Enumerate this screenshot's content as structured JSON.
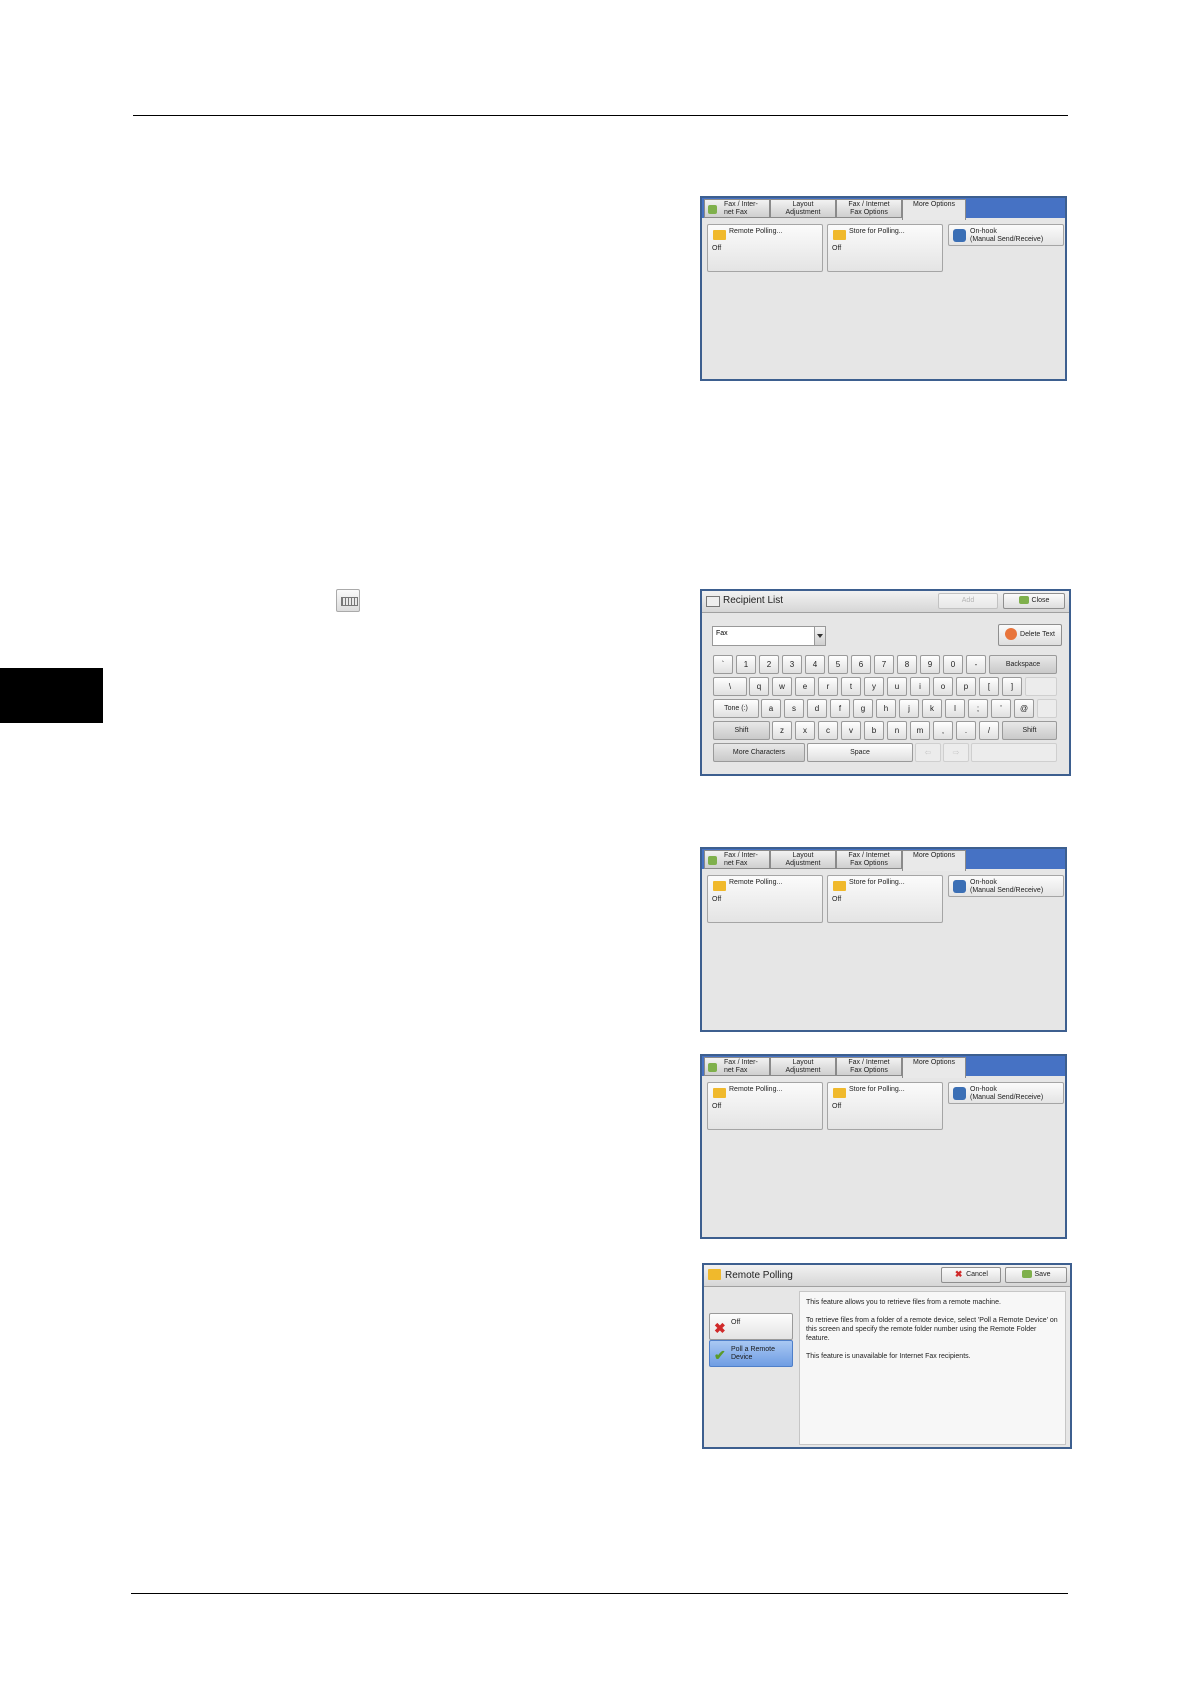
{
  "fax_tabs": {
    "tabs": [
      "Fax / Inter-\nnet Fax",
      "Layout\nAdjustment",
      "Fax / Internet\nFax Options",
      "More Options"
    ],
    "tab0_l1": "Fax / Inter-",
    "tab0_l2": "net Fax",
    "tab1_l1": "Layout",
    "tab1_l2": "Adjustment",
    "tab2_l1": "Fax / Internet",
    "tab2_l2": "Fax Options",
    "tab3": "More Options",
    "remote_polling_label": "Remote Polling...",
    "remote_polling_value": "Off",
    "store_polling_label": "Store for Polling...",
    "store_polling_value": "Off",
    "onhook_l1": "On-hook",
    "onhook_l2": "(Manual Send/Receive)"
  },
  "recipient_list": {
    "title": "Recipient List",
    "add_label": "Add",
    "close_label": "Close",
    "dropdown_value": "Fax",
    "delete_text_label": "Delete Text",
    "row1": [
      "`",
      "1",
      "2",
      "3",
      "4",
      "5",
      "6",
      "7",
      "8",
      "9",
      "0",
      "-"
    ],
    "backspace_label": "Backspace",
    "row2": [
      "\\",
      "q",
      "w",
      "e",
      "r",
      "t",
      "y",
      "u",
      "i",
      "o",
      "p",
      "[",
      "]"
    ],
    "tone_label": "Tone (:)",
    "row3": [
      "a",
      "s",
      "d",
      "f",
      "g",
      "h",
      "j",
      "k",
      "l",
      ";",
      "'",
      "@"
    ],
    "shift_label": "Shift",
    "row4": [
      "z",
      "x",
      "c",
      "v",
      "b",
      "n",
      "m",
      ",",
      ".",
      "/"
    ],
    "more_characters_label": "More Characters",
    "space_label": "Space",
    "arrow_left": "⇦",
    "arrow_right": "⇨"
  },
  "remote_polling": {
    "title": "Remote Polling",
    "cancel_label": "Cancel",
    "save_label": "Save",
    "option_off": "Off",
    "option_poll": "Poll a Remote Device",
    "desc_p1": "This feature allows you to retrieve files from a remote machine.",
    "desc_p2": "To retrieve files from a folder of a remote device, select 'Poll a Remote Device' on this screen and specify the remote folder number using the Remote Folder feature.",
    "desc_p3": "This feature is unavailable for Internet Fax recipients."
  }
}
